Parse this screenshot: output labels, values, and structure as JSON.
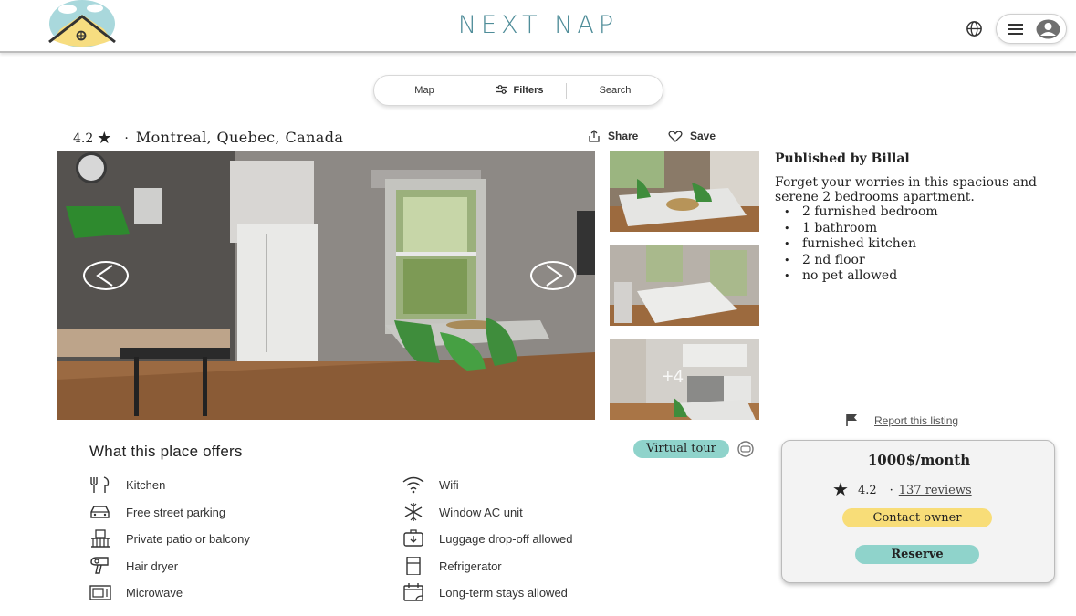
{
  "header": {
    "brand": "NEXT NAP",
    "logo_icon": "house-logo-icon",
    "globe_icon": "globe-icon",
    "menu_icon": "hamburger-icon",
    "avatar_icon": "user-avatar-icon"
  },
  "search_bar": {
    "map_label": "Map",
    "filters_label": "Filters",
    "search_label": "Search"
  },
  "listing": {
    "rating": "4.2",
    "location": "Montreal, Quebec, Canada",
    "share_label": "Share",
    "save_label": "Save",
    "more_photos": "+4"
  },
  "description": {
    "publisher": "Published by Billal",
    "text": "Forget your worries in this spacious and serene 2 bedrooms apartment.",
    "features": [
      "2 furnished bedroom",
      "1 bathroom",
      "furnished kitchen",
      "2 nd floor",
      "no pet allowed"
    ],
    "report_label": "Report this listing"
  },
  "offers": {
    "title": "What this place offers",
    "virtual_tour_label": "Virtual tour",
    "left": [
      {
        "label": "Kitchen",
        "icon": "utensils-icon"
      },
      {
        "label": "Free street parking",
        "icon": "car-icon"
      },
      {
        "label": "Private patio or balcony",
        "icon": "balcony-icon"
      },
      {
        "label": "Hair dryer",
        "icon": "hair-dryer-icon"
      },
      {
        "label": "Microwave",
        "icon": "microwave-icon"
      }
    ],
    "right": [
      {
        "label": "Wifi",
        "icon": "wifi-icon"
      },
      {
        "label": "Window AC unit",
        "icon": "snowflake-icon"
      },
      {
        "label": "Luggage drop-off allowed",
        "icon": "luggage-icon"
      },
      {
        "label": "Refrigerator",
        "icon": "refrigerator-icon"
      },
      {
        "label": "Long-term stays allowed",
        "icon": "calendar-icon"
      }
    ]
  },
  "booking": {
    "price": "1000$/month",
    "rating": "4.2",
    "reviews": "137 reviews",
    "contact_label": "Contact owner",
    "reserve_label": "Reserve"
  },
  "colors": {
    "brand": "#4f8d99",
    "teal_button": "#8fd3cb",
    "yellow_button": "#f8dd78"
  }
}
